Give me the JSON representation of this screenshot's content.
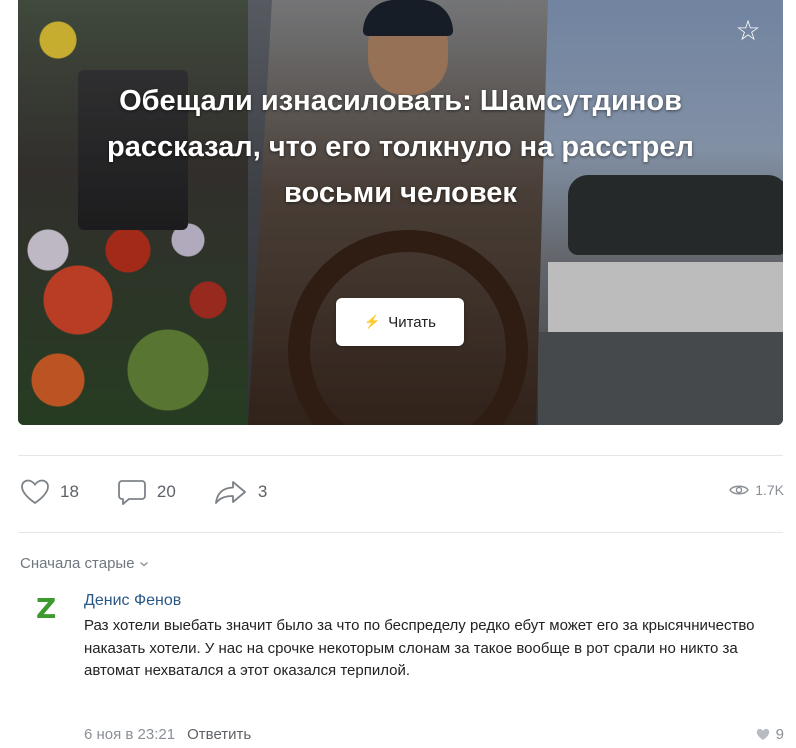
{
  "post": {
    "headline": [
      "Обещали изнасиловать: Шамсутдинов",
      "рассказал, что его толкнуло на расстрел",
      "восьми человек"
    ],
    "read_button": "Читать"
  },
  "actions": {
    "likes": "18",
    "comments": "20",
    "shares": "3",
    "views": "1.7K"
  },
  "comments_section": {
    "sort_label": "Сначала старые",
    "items": [
      {
        "avatar_letter": "Z",
        "author": "Денис Фенов",
        "text": "Раз хотели выебать значит было за что по беспределу редко ебут может его за крысячничество наказать хотели. У нас на срочке некоторым слонам за такое вообще в рот срали но никто за автомат нехватался а этот оказался терпилой.",
        "date": "6 ноя в 23:21",
        "reply_label": "Ответить",
        "likes": "9"
      }
    ]
  },
  "colors": {
    "link": "#2a5885",
    "muted": "#8a8f96",
    "avatar": "#3c9a2e"
  }
}
